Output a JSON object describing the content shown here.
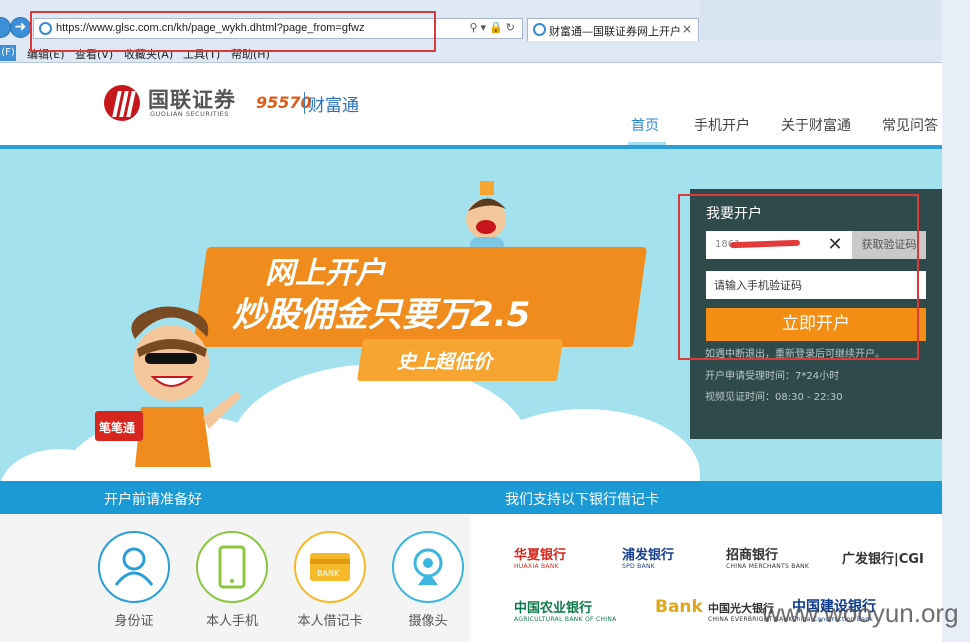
{
  "browser": {
    "url": "https://www.glsc.com.cn/kh/page_wykh.dhtml?page_from=gfwz",
    "tab_title": "财富通—国联证券网上开户",
    "tab_close": "×",
    "menu_stub": "(F)",
    "menu": [
      "编辑(E)",
      "查看(V)",
      "收藏夹(A)",
      "工具(T)",
      "帮助(H)"
    ],
    "icons": [
      "back-icon",
      "forward-icon",
      "ie-icon",
      "search-icon",
      "lock-icon",
      "refresh-icon",
      "close-icon"
    ]
  },
  "header": {
    "logo_cn": "国联证券",
    "logo_en": "GUOLIAN SECURITIES",
    "hotline": "95570",
    "product": "财富通",
    "nav": [
      "首页",
      "手机开户",
      "关于财富通",
      "常见问答"
    ],
    "active_nav": "首页"
  },
  "banner": {
    "line1": "网上开户",
    "line2": "炒股佣金只要万2.5",
    "line3": "史上超低价",
    "mascot_tag": "笔笔通"
  },
  "panel": {
    "title": "我要开户",
    "phone_value": "1861",
    "clear": "✕",
    "get_code": "获取验证码",
    "code_placeholder": "请输入手机验证码",
    "submit": "立即开户",
    "notes": [
      "如遇中断退出，重新登录后可继续开户。",
      "开户申请受理时间：7*24小时",
      "视频见证时间：08:30 - 22:30"
    ]
  },
  "prep": {
    "title": "开户前请准备好",
    "items": [
      {
        "label": "身份证",
        "icon": "person-icon",
        "color": "#2b9ed8"
      },
      {
        "label": "本人手机",
        "icon": "phone-icon",
        "color": "#8cc63f"
      },
      {
        "label": "本人借记卡",
        "icon": "bank-card-icon",
        "color": "#f5b92a"
      },
      {
        "label": "摄像头",
        "icon": "webcam-icon",
        "color": "#3ab6e0"
      }
    ],
    "card_text": "BANK"
  },
  "banks": {
    "title": "我们支持以下银行借记卡",
    "list": [
      {
        "name": "华夏银行",
        "sub": "HUAXIA BANK",
        "color": "#d7261e"
      },
      {
        "name": "浦发银行",
        "sub": "SPD BANK",
        "color": "#1a3f8f"
      },
      {
        "name": "招商银行",
        "sub": "CHINA MERCHANTS BANK",
        "color": "#333333"
      },
      {
        "name": "广发银行|CGI",
        "sub": "",
        "color": "#333333"
      },
      {
        "name": "中国农业银行",
        "sub": "AGRICULTURAL BANK OF CHINA",
        "color": "#0c7a4a"
      },
      {
        "name": "Bank",
        "sub": "",
        "color": "#e0a71a"
      },
      {
        "name": "中国光大银行",
        "sub": "CHINA EVERBRIGHT BANK",
        "color": "#333333"
      },
      {
        "name": "中国建设银行",
        "sub": "China Construction Bank",
        "color": "#0d3a8c"
      }
    ]
  },
  "watermark": "www.wooyun.org"
}
